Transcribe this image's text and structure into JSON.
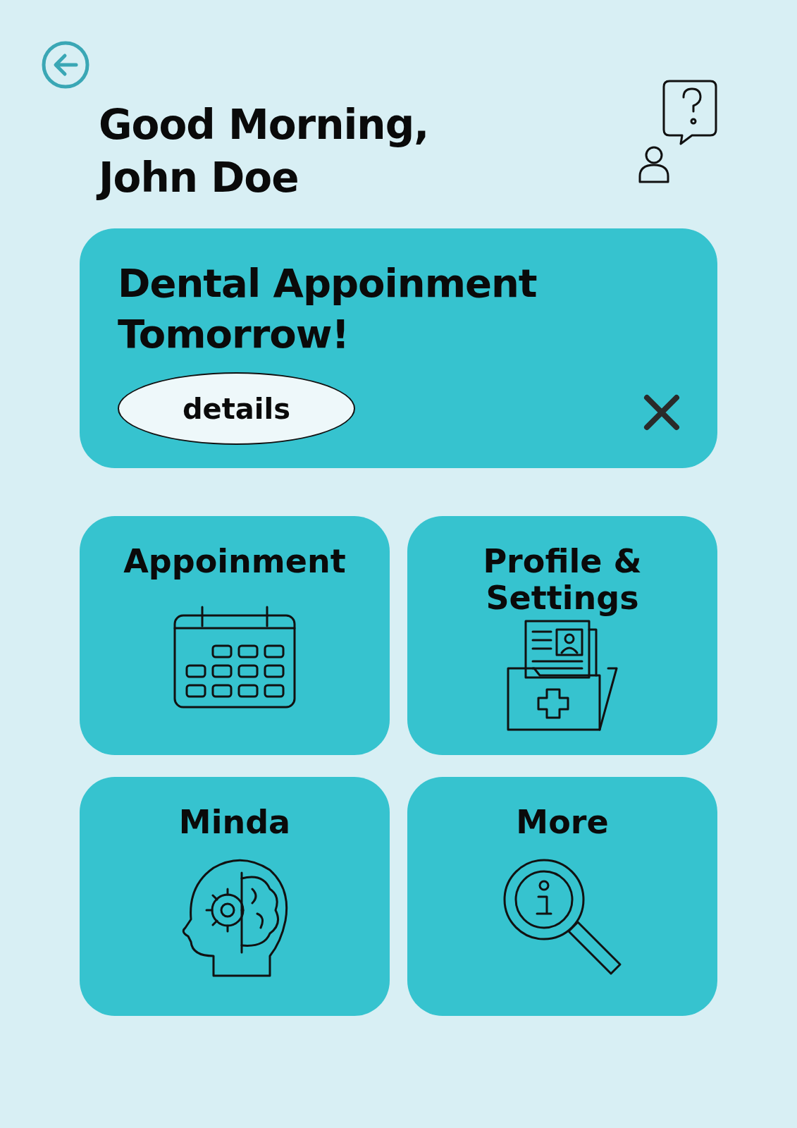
{
  "greeting": {
    "lines": [
      "Good Morning,",
      "John Doe"
    ]
  },
  "banner": {
    "title_lines": [
      "Dental Appoinment",
      "Tomorrow!"
    ],
    "button": "details"
  },
  "tiles": [
    {
      "label_lines": [
        "Appoinment"
      ],
      "kind": "calendar"
    },
    {
      "label_lines": [
        "Profile &",
        "Settings"
      ],
      "kind": "records"
    },
    {
      "label_lines": [
        "Minda"
      ],
      "kind": "mind"
    },
    {
      "label_lines": [
        "More"
      ],
      "kind": "info"
    }
  ]
}
